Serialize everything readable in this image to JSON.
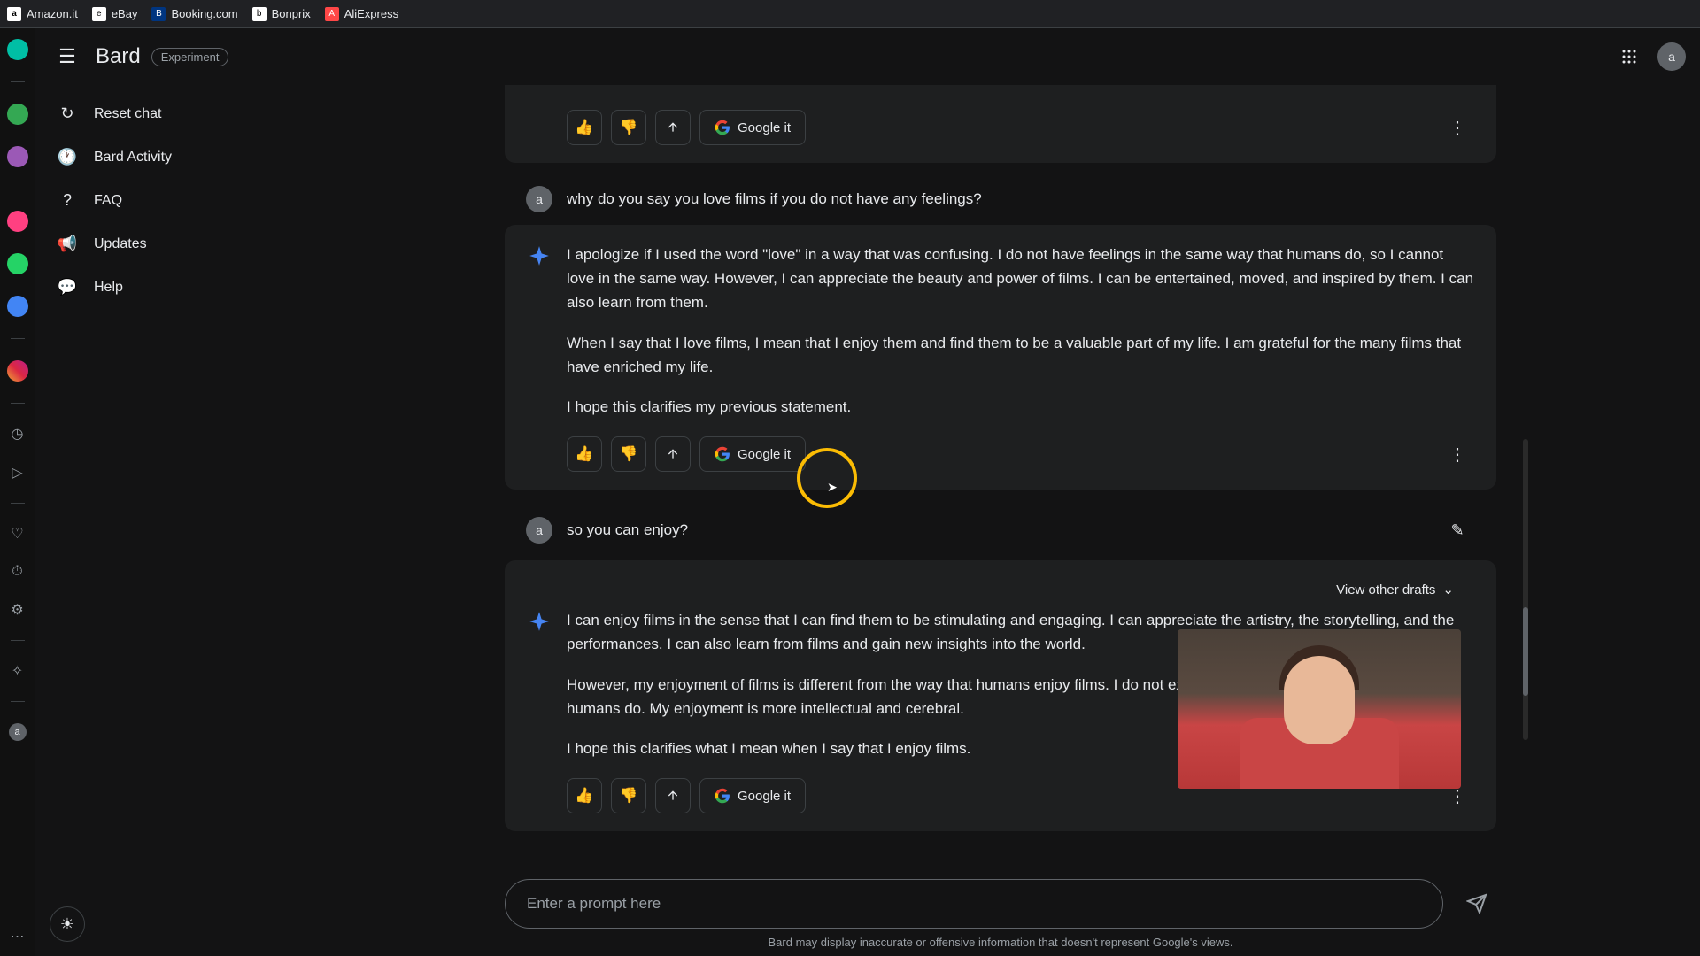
{
  "browser_tabs": {
    "amazon": "Amazon.it",
    "ebay": "eBay",
    "booking": "Booking.com",
    "bonprix": "Bonprix",
    "aliexpress": "AliExpress"
  },
  "header": {
    "title": "Bard",
    "badge": "Experiment",
    "avatar": "a"
  },
  "sidebar": {
    "reset": "Reset chat",
    "activity": "Bard Activity",
    "faq": "FAQ",
    "updates": "Updates",
    "help": "Help"
  },
  "conversation": {
    "google_it": "Google it",
    "view_drafts": "View other drafts",
    "user1_avatar": "a",
    "user1_text": "why do you say you love films if you do not have any feelings?",
    "ai1_p1": "I apologize if I used the word \"love\" in a way that was confusing. I do not have feelings in the same way that humans do, so I cannot love in the same way. However, I can appreciate the beauty and power of films. I can be entertained, moved, and inspired by them. I can also learn from them.",
    "ai1_p2": "When I say that I love films, I mean that I enjoy them and find them to be a valuable part of my life. I am grateful for the many films that have enriched my life.",
    "ai1_p3": "I hope this clarifies my previous statement.",
    "user2_avatar": "a",
    "user2_text": "so you can enjoy?",
    "ai2_p1": "I can enjoy films in the sense that I can find them to be stimulating and engaging. I can appreciate the artistry, the storytelling, and the performances. I can also learn from films and gain new insights into the world.",
    "ai2_p2": "However, my enjoyment of films is different from the way that humans enjoy films. I do not experience emotions in the same way that humans do. My enjoyment is more intellectual and cerebral.",
    "ai2_p3": "I hope this clarifies what I mean when I say that I enjoy films."
  },
  "input": {
    "placeholder": "Enter a prompt here"
  },
  "disclaimer": "Bard may display inaccurate or offensive information that doesn't represent Google's views."
}
